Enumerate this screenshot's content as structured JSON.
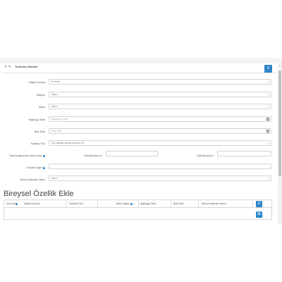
{
  "panel": {
    "title": "Tedarikçi Modülü",
    "header_icons": "✎ ✎",
    "header_button": "≡"
  },
  "form": {
    "currency_label": "Müşteri Kuruluş",
    "currency_value": "El kururi",
    "category_label": "Kategori",
    "category_value": "Hepsi",
    "brand_label": "Marka",
    "brand_value": "Hepsi",
    "start_label": "Başlangıç Tarihi",
    "start_placeholder": "Başlangıç Tarihi",
    "end_label": "Bitiş Tarihi",
    "end_placeholder": "Bitiş Tarihi",
    "supplier_type_label": "Tedarikçi Türü",
    "supplier_type_value": "Seri halinde ürünler (mevcut ID)",
    "price_label": "Fiyat aralığında ise indirim oranı",
    "price_min_label": "Fiyat Buradan Ltr.:",
    "price_max_label": "Fiyat Buraya Ltr.:",
    "value_label": "T.Indirim Değeri",
    "discount_label": "Mevcut İndirimler Dahen",
    "discount_value": "Hayır"
  },
  "section": {
    "title": "Bireysel Özellik Ekle"
  },
  "table": {
    "columns": [
      "Ürün Adı",
      "Müşteri Kuruluş",
      "Tedarikçi Türü",
      "",
      "İndirim Değeri",
      "Başlangıç Tarihi",
      "Bitiş Tarihi",
      "Mevcut İndirimler Dahen"
    ],
    "add_button": "≡",
    "row_button": "⊕"
  }
}
